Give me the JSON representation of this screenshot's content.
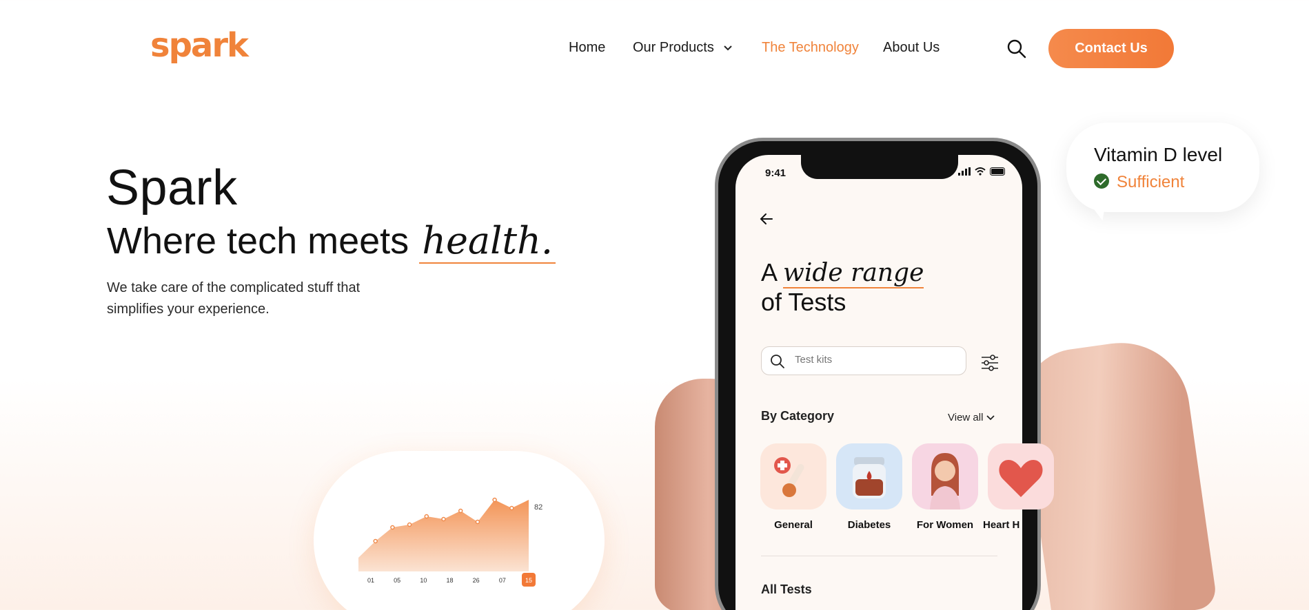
{
  "brand": {
    "logo": "spark",
    "accent": "#f0833a"
  },
  "nav": {
    "items": [
      {
        "label": "Home"
      },
      {
        "label": "Our Products"
      },
      {
        "label": "The Technology"
      },
      {
        "label": "About Us"
      }
    ],
    "contact_label": "Contact Us"
  },
  "hero": {
    "title": "Spark",
    "subtitle_prefix": "Where tech meets",
    "subtitle_script": "health",
    "subtitle_dot": ".",
    "description": "We take care of the complicated stuff that simplifies your experience."
  },
  "chart_card": {
    "chart_data": {
      "type": "area",
      "x": [
        "01",
        "05",
        "10",
        "18",
        "26",
        "07",
        "15"
      ],
      "values": [
        40,
        52,
        62,
        64,
        70,
        68,
        74,
        66,
        82,
        76,
        82
      ],
      "highlight_value": "82",
      "highlight_x": "15"
    }
  },
  "phone": {
    "status_time": "9:41",
    "title_prefix": "A",
    "title_script": "wide range",
    "title_line2": "of Tests",
    "search_placeholder": "Test kits",
    "by_category": "By Category",
    "view_all": "View all",
    "categories": [
      {
        "label": "General"
      },
      {
        "label": "Diabetes"
      },
      {
        "label": "For Women"
      },
      {
        "label": "Heart H"
      }
    ],
    "all_tests": "All Tests"
  },
  "vitamin": {
    "title": "Vitamin D level",
    "status": "Sufficient"
  }
}
